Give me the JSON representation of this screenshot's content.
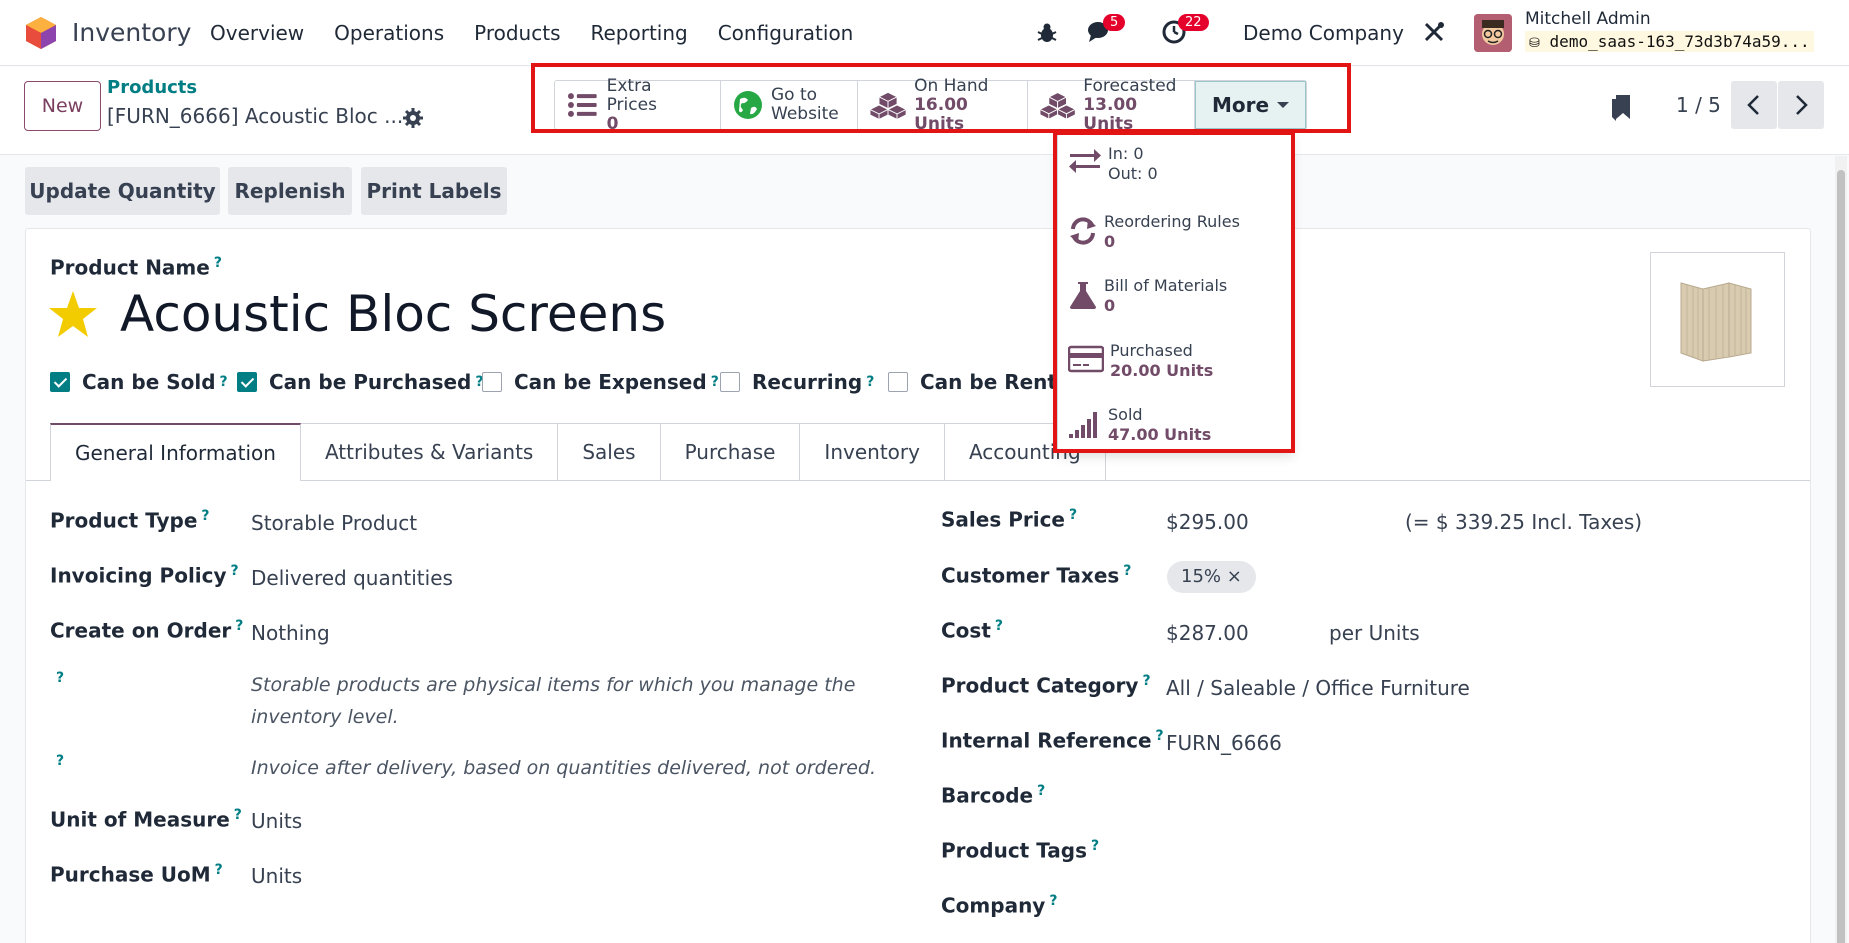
{
  "navbar": {
    "app_name": "Inventory",
    "menu": [
      "Overview",
      "Operations",
      "Products",
      "Reporting",
      "Configuration"
    ],
    "messages_count": "5",
    "activities_count": "22",
    "company": "Demo Company",
    "user_name": "Mitchell Admin",
    "db_name": "demo_saas-163_73d3b74a59..."
  },
  "control": {
    "new_label": "New",
    "breadcrumb_parent": "Products",
    "breadcrumb_current": "[FURN_6666] Acoustic Bloc ...",
    "pager": "1 / 5"
  },
  "smart_buttons": [
    {
      "label": "Extra Prices",
      "value": "0",
      "icon": "list-icon"
    },
    {
      "label": "Go to",
      "value": "Website",
      "icon": "globe-icon"
    },
    {
      "label": "On Hand",
      "value": "16.00 Units",
      "icon": "cubes-icon"
    },
    {
      "label": "Forecasted",
      "value": "13.00 Units",
      "icon": "cubes-icon"
    }
  ],
  "more_label": "More",
  "dropdown": [
    {
      "label": "In: 0",
      "value": "Out: 0",
      "icon": "exchange-icon"
    },
    {
      "label": "Reordering Rules",
      "value": "0",
      "icon": "refresh-icon"
    },
    {
      "label": "Bill of Materials",
      "value": "0",
      "icon": "flask-icon"
    },
    {
      "label": "Purchased",
      "value": "20.00 Units",
      "icon": "credit-card-icon"
    },
    {
      "label": "Sold",
      "value": "47.00 Units",
      "icon": "signal-icon"
    }
  ],
  "actions": [
    "Update Quantity",
    "Replenish",
    "Print Labels"
  ],
  "form": {
    "product_name_label": "Product Name",
    "product_name": "Acoustic Bloc Screens",
    "checkboxes": [
      {
        "label": "Can be Sold",
        "checked": true
      },
      {
        "label": "Can be Purchased",
        "checked": true
      },
      {
        "label": "Can be Expensed",
        "checked": false
      },
      {
        "label": "Recurring",
        "checked": false
      },
      {
        "label": "Can be Rented",
        "checked": false
      }
    ],
    "tabs": [
      "General Information",
      "Attributes & Variants",
      "Sales",
      "Purchase",
      "Inventory",
      "Accounting"
    ],
    "left": {
      "product_type_label": "Product Type",
      "product_type": "Storable Product",
      "invoicing_policy_label": "Invoicing Policy",
      "invoicing_policy": "Delivered quantities",
      "create_on_order_label": "Create on Order",
      "create_on_order": "Nothing",
      "help1_line1": "Storable products are physical items for which you manage the",
      "help1_line2": "inventory level.",
      "help2": "Invoice after delivery, based on quantities delivered, not ordered.",
      "uom_label": "Unit of Measure",
      "uom": "Units",
      "purchase_uom_label": "Purchase UoM",
      "purchase_uom": "Units"
    },
    "right": {
      "sales_price_label": "Sales Price",
      "sales_price": "$295.00",
      "incl_taxes": "(= $ 339.25 Incl. Taxes)",
      "customer_taxes_label": "Customer Taxes",
      "customer_tax": "15%",
      "cost_label": "Cost",
      "cost": "$287.00",
      "cost_unit": "per Units",
      "category_label": "Product Category",
      "category": "All / Saleable / Office Furniture",
      "internal_ref_label": "Internal Reference",
      "internal_ref": "FURN_6666",
      "barcode_label": "Barcode",
      "tags_label": "Product Tags",
      "company_label": "Company"
    }
  },
  "colors": {
    "accent": "#714b67",
    "teal": "#017e84",
    "highlight": "#e31414"
  }
}
